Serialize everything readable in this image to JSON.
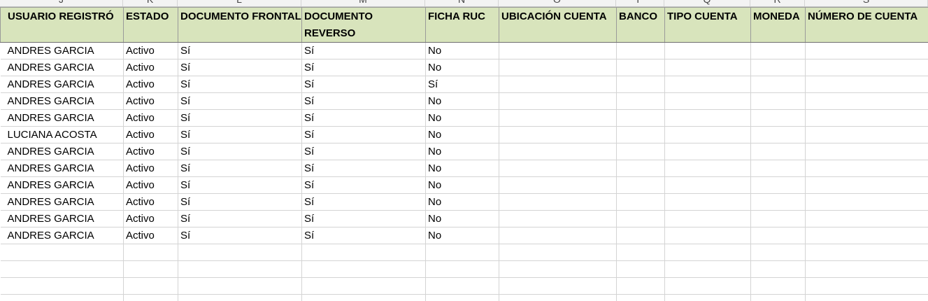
{
  "column_letters": [
    "J",
    "K",
    "L",
    "M",
    "N",
    "O",
    "P",
    "Q",
    "R",
    "S"
  ],
  "headers": [
    "USUARIO REGISTRÓ",
    "ESTADO",
    "DOCUMENTO FRONTAL",
    "DOCUMENTO REVERSO",
    "FICHA RUC",
    "UBICACIÓN CUENTA",
    "BANCO",
    "TIPO CUENTA",
    "MONEDA",
    "NÚMERO DE CUENTA"
  ],
  "rows": [
    [
      "ANDRES GARCIA",
      "Activo",
      "Sí",
      "Sí",
      "No",
      "",
      "",
      "",
      "",
      ""
    ],
    [
      "ANDRES GARCIA",
      "Activo",
      "Sí",
      "Sí",
      "No",
      "",
      "",
      "",
      "",
      ""
    ],
    [
      "ANDRES GARCIA",
      "Activo",
      "Sí",
      "Sí",
      "Sí",
      "",
      "",
      "",
      "",
      ""
    ],
    [
      "ANDRES GARCIA",
      "Activo",
      "Sí",
      "Sí",
      "No",
      "",
      "",
      "",
      "",
      ""
    ],
    [
      "ANDRES GARCIA",
      "Activo",
      "Sí",
      "Sí",
      "No",
      "",
      "",
      "",
      "",
      ""
    ],
    [
      "LUCIANA ACOSTA",
      "Activo",
      "Sí",
      "Sí",
      "No",
      "",
      "",
      "",
      "",
      ""
    ],
    [
      "ANDRES GARCIA",
      "Activo",
      "Sí",
      "Sí",
      "No",
      "",
      "",
      "",
      "",
      ""
    ],
    [
      "ANDRES GARCIA",
      "Activo",
      "Sí",
      "Sí",
      "No",
      "",
      "",
      "",
      "",
      ""
    ],
    [
      "ANDRES GARCIA",
      "Activo",
      "Sí",
      "Sí",
      "No",
      "",
      "",
      "",
      "",
      ""
    ],
    [
      "ANDRES GARCIA",
      "Activo",
      "Sí",
      "Sí",
      "No",
      "",
      "",
      "",
      "",
      ""
    ],
    [
      "ANDRES GARCIA",
      "Activo",
      "Sí",
      "Sí",
      "No",
      "",
      "",
      "",
      "",
      ""
    ],
    [
      "ANDRES GARCIA",
      "Activo",
      "Sí",
      "Sí",
      "No",
      "",
      "",
      "",
      "",
      ""
    ],
    [
      "",
      "",
      "",
      "",
      "",
      "",
      "",
      "",
      "",
      ""
    ],
    [
      "",
      "",
      "",
      "",
      "",
      "",
      "",
      "",
      "",
      ""
    ],
    [
      "",
      "",
      "",
      "",
      "",
      "",
      "",
      "",
      "",
      ""
    ],
    [
      "",
      "",
      "",
      "",
      "",
      "",
      "",
      "",
      "",
      ""
    ]
  ],
  "colors": {
    "header_fill": "#d8e4bc",
    "gridline": "#d4d4d4"
  }
}
